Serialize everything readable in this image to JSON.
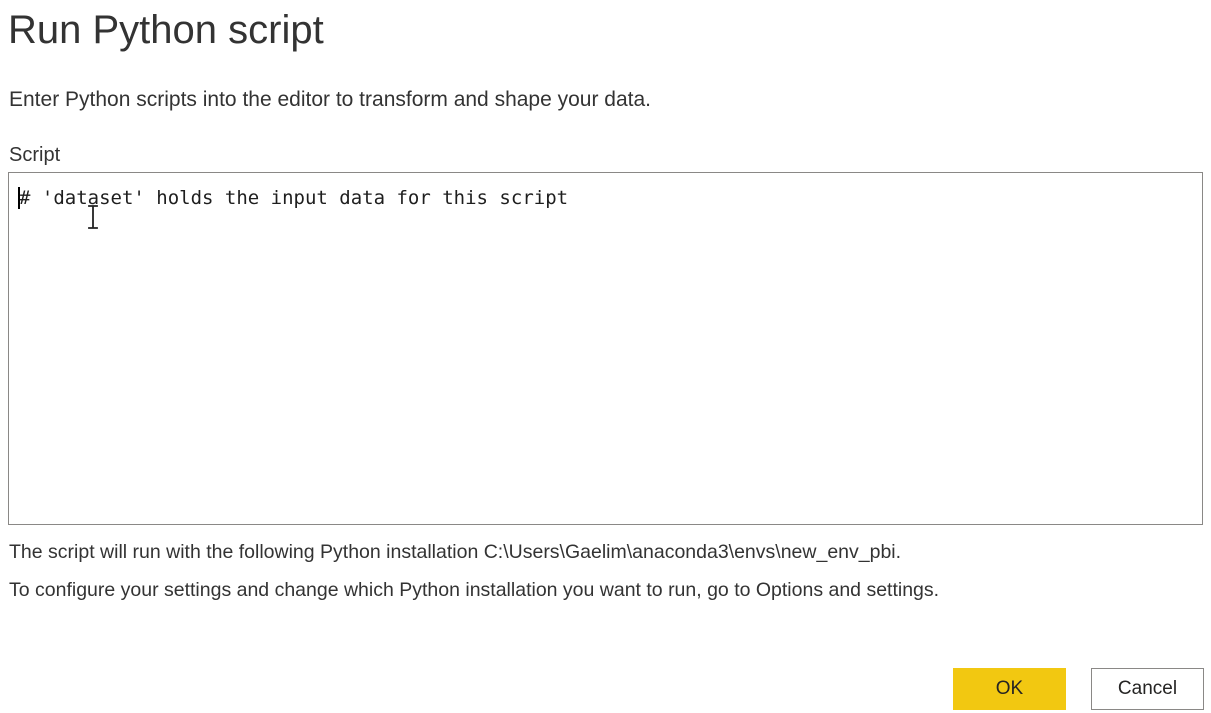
{
  "dialog": {
    "title": "Run Python script",
    "description": "Enter Python scripts into the editor to transform and shape your data.",
    "script_label": "Script",
    "script_text": "# 'dataset' holds the input data for this script",
    "installation_note": "The script will run with the following Python installation C:\\Users\\Gaelim\\anaconda3\\envs\\new_env_pbi.",
    "settings_note": "To configure your settings and change which Python installation you want to run, go to Options and settings."
  },
  "buttons": {
    "ok_label": "OK",
    "cancel_label": "Cancel"
  },
  "colors": {
    "ok_button_background": "#f2c811",
    "editor_border": "#8a8886",
    "text": "#333333"
  },
  "icons": {
    "mouse_cursor": "ibeam-cursor-icon",
    "text_caret": "text-caret"
  }
}
